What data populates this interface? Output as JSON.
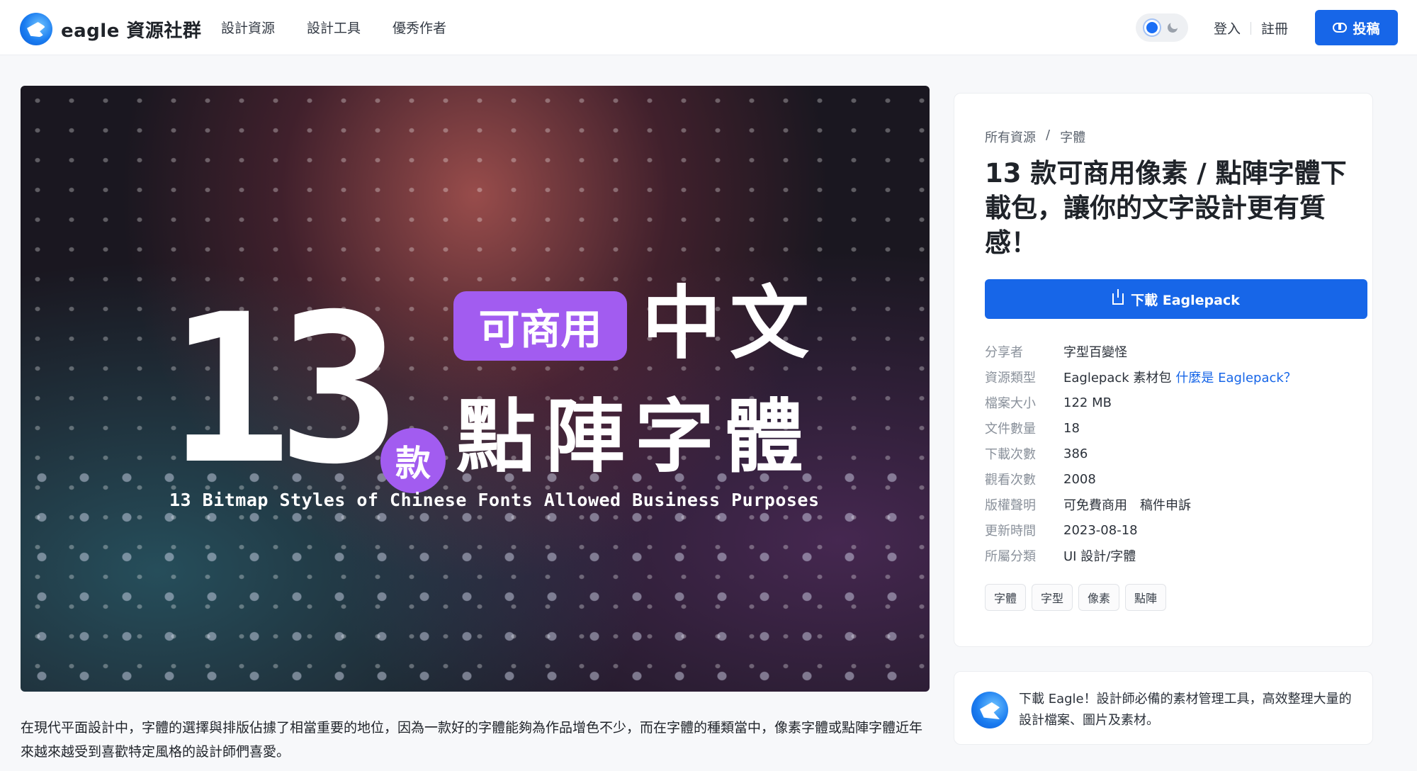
{
  "header": {
    "logo_text": "eagle 資源社群",
    "nav": [
      "設計資源",
      "設計工具",
      "優秀作者"
    ],
    "login": "登入",
    "register": "註冊",
    "post_button": "投稿"
  },
  "hero": {
    "big_number": "13",
    "pill_text": "可商用",
    "line1": "中文",
    "kuan": "款",
    "line2": "點陣字體",
    "english": "13 Bitmap Styles of Chinese Fonts Allowed Business Purposes"
  },
  "description": "在現代平面設計中，字體的選擇與排版佔據了相當重要的地位，因為一款好的字體能夠為作品增色不少，而在字體的種類當中，像素字體或點陣字體近年來越來越受到喜歡特定風格的設計師們喜愛。",
  "info": {
    "breadcrumb": [
      "所有資源",
      "/",
      "字體"
    ],
    "title": "13 款可商用像素 / 點陣字體下載包，讓你的文字設計更有質感！",
    "download_button": "下載 Eaglepack",
    "meta": [
      {
        "key": "分享者",
        "value": "字型百變怪"
      },
      {
        "key": "資源類型",
        "value": "Eaglepack 素材包",
        "link": "什麼是 Eaglepack？"
      },
      {
        "key": "檔案大小",
        "value": "122 MB"
      },
      {
        "key": "文件數量",
        "value": "18"
      },
      {
        "key": "下載次數",
        "value": "386"
      },
      {
        "key": "觀看次數",
        "value": "2008"
      },
      {
        "key": "版權聲明",
        "value": "可免費商用",
        "extra": "稿件申訴"
      },
      {
        "key": "更新時間",
        "value": "2023-08-18"
      },
      {
        "key": "所屬分類",
        "value": "UI 設計/字體"
      }
    ],
    "tags": [
      "字體",
      "字型",
      "像素",
      "點陣"
    ]
  },
  "promo": {
    "text": "下載 Eagle！設計師必備的素材管理工具，高效整理大量的設計檔案、圖片及素材。"
  },
  "colors": {
    "accent": "#1766e8",
    "purple": "#a25cf0"
  }
}
